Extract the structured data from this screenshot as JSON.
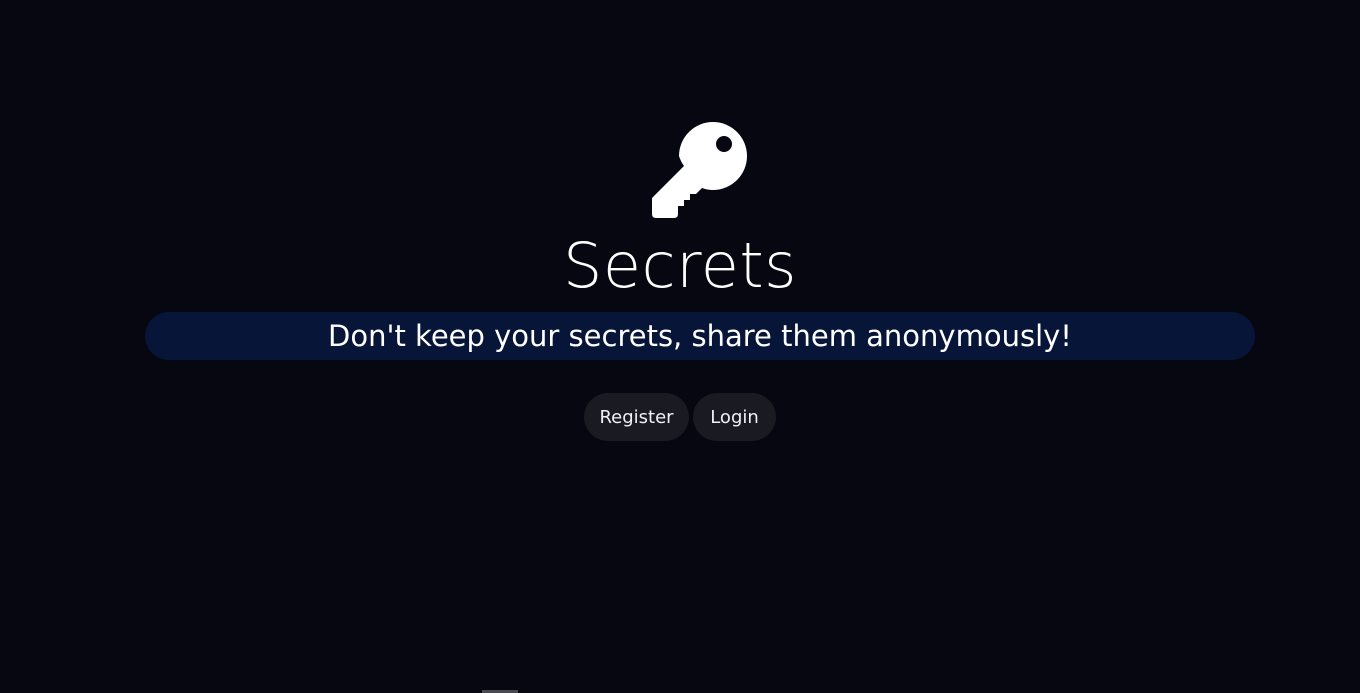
{
  "hero": {
    "icon": "key-icon",
    "title": "Secrets",
    "tagline": "Don't keep your secrets, share them anonymously!"
  },
  "actions": {
    "register_label": "Register",
    "login_label": "Login"
  },
  "colors": {
    "background": "#070712",
    "tagline_bar": "#071538",
    "button": "#1a1a22",
    "text": "#ffffff"
  }
}
